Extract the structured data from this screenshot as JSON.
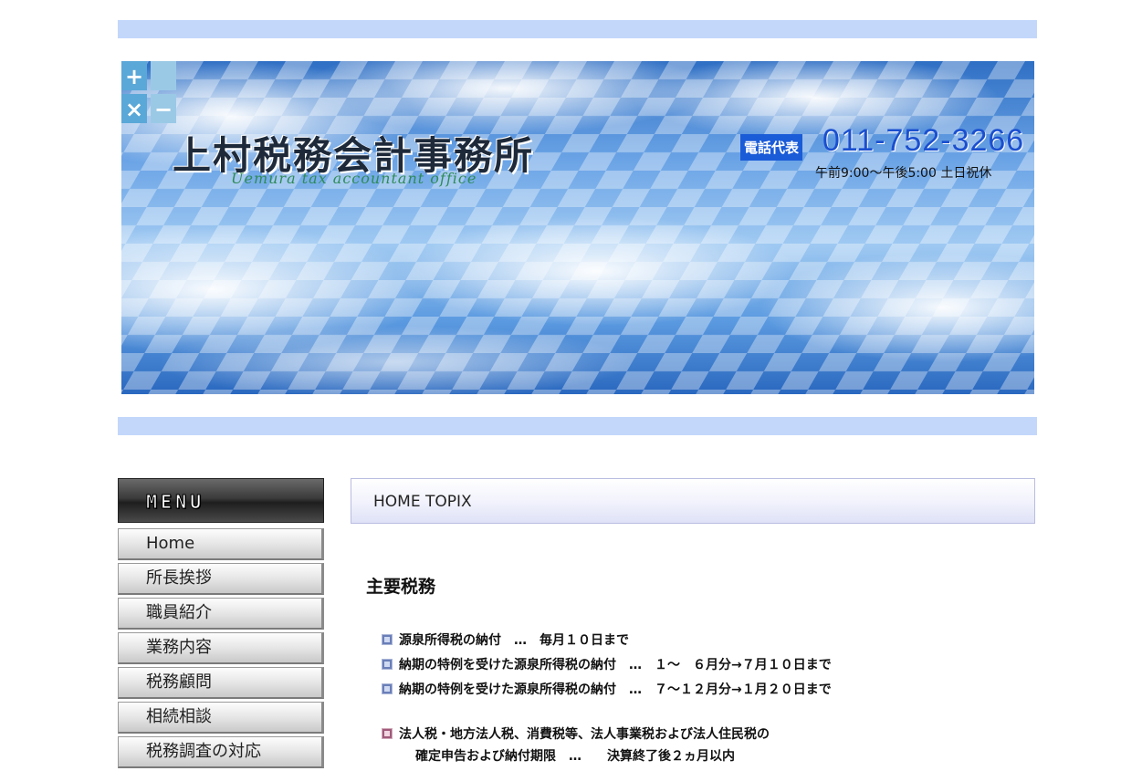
{
  "header": {
    "office_name": "上村税務会計事務所",
    "office_name_en": "Uemura tax accountant office",
    "tel_label": "電話代表",
    "tel_number": "011-752-3266",
    "hours": "午前9:00～午後5:00 土日祝休"
  },
  "menu": {
    "title": "MENU",
    "items": [
      {
        "label": "Home"
      },
      {
        "label": "所長挨拶"
      },
      {
        "label": "職員紹介"
      },
      {
        "label": "業務内容"
      },
      {
        "label": "税務顧問"
      },
      {
        "label": "相続相談"
      },
      {
        "label": "税務調査の対応"
      }
    ]
  },
  "main": {
    "topix_title": "HOME TOPIX",
    "section_title": "主要税務",
    "items": [
      "源泉所得税の納付　…　毎月１０日まで",
      "納期の特例を受けた源泉所得税の納付　…　１～　６月分→７月１０日まで",
      "納期の特例を受けた源泉所得税の納付　…　７～１２月分→１月２０日まで"
    ],
    "corp_item": "法人税・地方法人税、消費税等、法人事業税および法人住民税の",
    "corp_item_cont": "確定申告および納付期限　…　　決算終了後２ヵ月以内"
  }
}
